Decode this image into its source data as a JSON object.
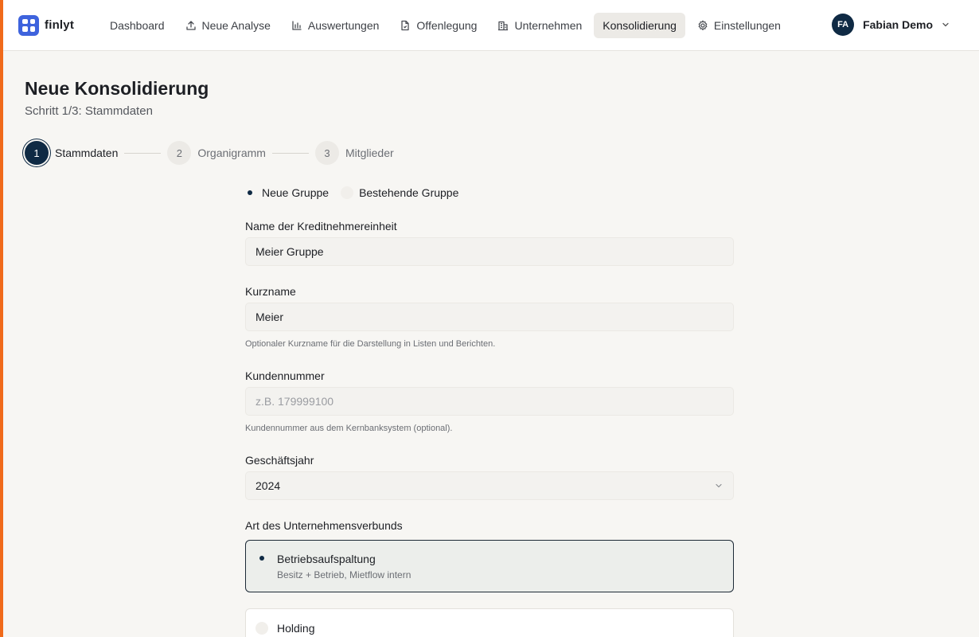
{
  "app": {
    "logo_text": "finlyt"
  },
  "nav": {
    "items": [
      {
        "label": "Dashboard",
        "icon": ""
      },
      {
        "label": "Neue Analyse",
        "icon": "upload-icon"
      },
      {
        "label": "Auswertungen",
        "icon": "bar-chart-icon"
      },
      {
        "label": "Offenlegung",
        "icon": "document-icon"
      },
      {
        "label": "Unternehmen",
        "icon": "building-icon"
      },
      {
        "label": "Konsolidierung",
        "icon": "",
        "active": true
      },
      {
        "label": "Einstellungen",
        "icon": "gear-icon"
      }
    ]
  },
  "user": {
    "initials": "FA",
    "name": "Fabian Demo"
  },
  "page": {
    "title": "Neue Konsolidierung",
    "subtitle": "Schritt 1/3: Stammdaten"
  },
  "stepper": {
    "steps": [
      {
        "number": "1",
        "label": "Stammdaten",
        "active": true
      },
      {
        "number": "2",
        "label": "Organigramm",
        "active": false
      },
      {
        "number": "3",
        "label": "Mitglieder",
        "active": false
      }
    ]
  },
  "form": {
    "group_type": {
      "options": [
        {
          "label": "Neue Gruppe",
          "selected": true
        },
        {
          "label": "Bestehende Gruppe",
          "selected": false
        }
      ]
    },
    "name": {
      "label": "Name der Kreditnehmereinheit",
      "value": "Meier Gruppe"
    },
    "short_name": {
      "label": "Kurzname",
      "value": "Meier",
      "hint": "Optionaler Kurzname für die Darstellung in Listen und Berichten."
    },
    "customer_number": {
      "label": "Kundennummer",
      "value": "",
      "placeholder": "z.B. 179999100",
      "hint": "Kundennummer aus dem Kernbanksystem (optional)."
    },
    "fiscal_year": {
      "label": "Geschäftsjahr",
      "value": "2024"
    },
    "group_kind": {
      "label": "Art des Unternehmensverbunds",
      "options": [
        {
          "title": "Betriebsaufspaltung",
          "description": "Besitz + Betrieb, Mietflow intern",
          "selected": true
        },
        {
          "title": "Holding",
          "description": "",
          "selected": false
        }
      ]
    }
  },
  "colors": {
    "accent_bar": "#f06a1a",
    "brand": "#3e63dd",
    "primary": "#0f2a44"
  }
}
